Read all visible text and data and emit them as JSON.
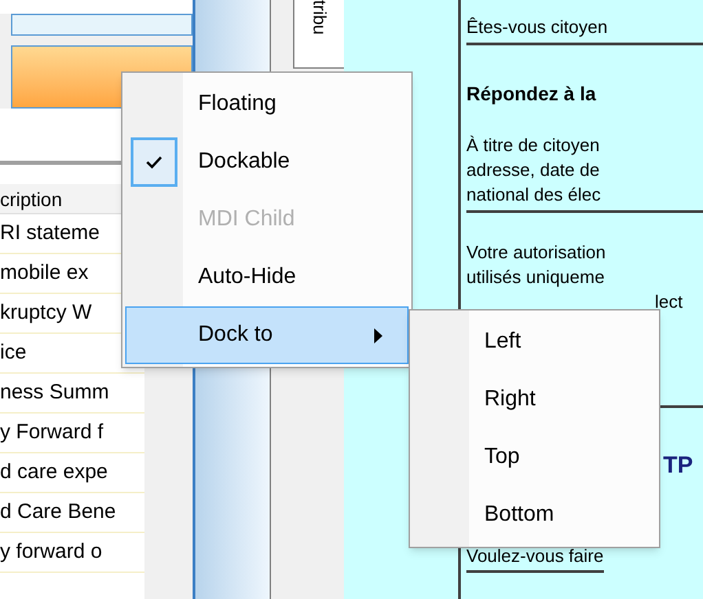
{
  "left_panel": {
    "column_header": "cription",
    "rows": [
      "RI stateme",
      "mobile ex",
      "kruptcy W",
      "ice",
      "ness Summ",
      "y Forward f",
      "d care expe",
      "d Care Bene",
      "y forward o"
    ]
  },
  "side_tab": {
    "label": "tribu"
  },
  "document": {
    "question": "Êtes-vous citoyen",
    "heading": "Répondez à la",
    "paragraph_1": [
      "À titre de citoyen",
      "adresse, date de",
      "national des élec"
    ],
    "paragraph_2": [
      "Votre autorisation",
      "utilisés uniqueme",
      "lect"
    ],
    "section_heading": "TP",
    "question_2": "Voulez-vous faire"
  },
  "context_menu": {
    "items": [
      {
        "label": "Floating",
        "checked": false,
        "disabled": false,
        "selected": false,
        "has_submenu": false
      },
      {
        "label": "Dockable",
        "checked": true,
        "disabled": false,
        "selected": false,
        "has_submenu": false
      },
      {
        "label": "MDI Child",
        "checked": false,
        "disabled": true,
        "selected": false,
        "has_submenu": false
      },
      {
        "label": "Auto-Hide",
        "checked": false,
        "disabled": false,
        "selected": false,
        "has_submenu": false
      },
      {
        "label": "Dock to",
        "checked": false,
        "disabled": false,
        "selected": true,
        "has_submenu": true
      }
    ]
  },
  "submenu": {
    "items": [
      "Left",
      "Right",
      "Top",
      "Bottom"
    ]
  }
}
